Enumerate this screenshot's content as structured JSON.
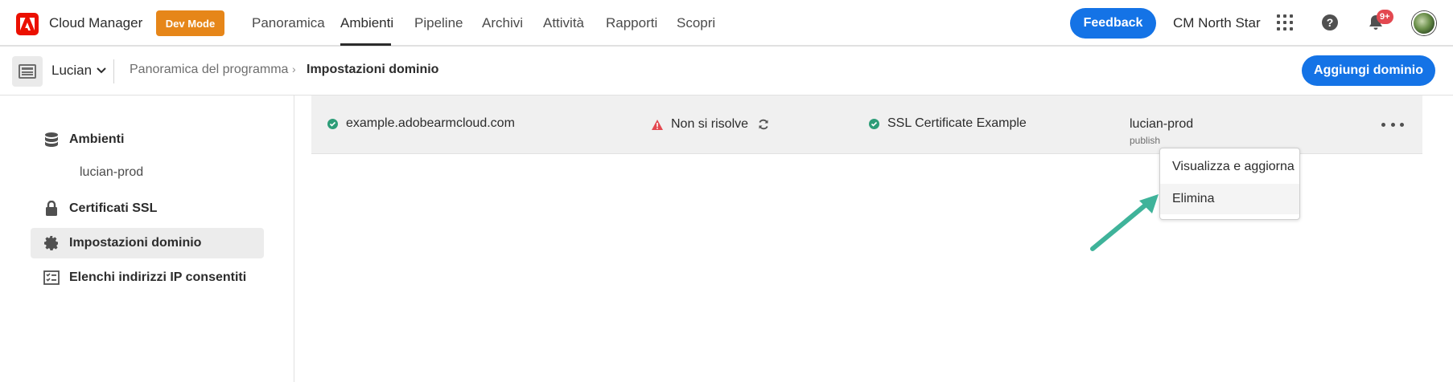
{
  "topnav": {
    "app_title": "Cloud Manager",
    "dev_mode": "Dev Mode",
    "tabs": [
      "Panoramica",
      "Ambienti",
      "Pipeline",
      "Archivi",
      "Attività",
      "Rapporti",
      "Scopri"
    ],
    "active_tab": "Ambienti",
    "feedback": "Feedback",
    "org": "CM North Star",
    "notification_badge": "9+"
  },
  "subheader": {
    "program": "Lucian",
    "breadcrumb": [
      "Panoramica del programma",
      "Impostazioni dominio"
    ],
    "add_button": "Aggiungi dominio"
  },
  "sidebar": {
    "items": [
      {
        "label": "Ambienti",
        "icon": "database-icon"
      },
      {
        "label": "lucian-prod",
        "icon": ""
      },
      {
        "label": "Certificati SSL",
        "icon": "lock-icon"
      },
      {
        "label": "Impostazioni dominio",
        "icon": "gear-icon",
        "selected": true
      },
      {
        "label": "Elenchi indirizzi IP consentiti",
        "icon": "checklist-icon"
      }
    ]
  },
  "row": {
    "domain": "example.adobearmcloud.com",
    "dns_status": "Non si risolve",
    "certificate": "SSL Certificate Example",
    "environment": "lucian-prod",
    "tier": "publish"
  },
  "menu": {
    "items": [
      "Visualizza e aggiorna",
      "Elimina"
    ],
    "hovered": "Elimina"
  },
  "colors": {
    "accent": "#1473e6",
    "dev_mode": "#e68619",
    "ok": "#2d9d78",
    "warn": "#e34850",
    "annotation_arrow": "#3fb39a"
  }
}
